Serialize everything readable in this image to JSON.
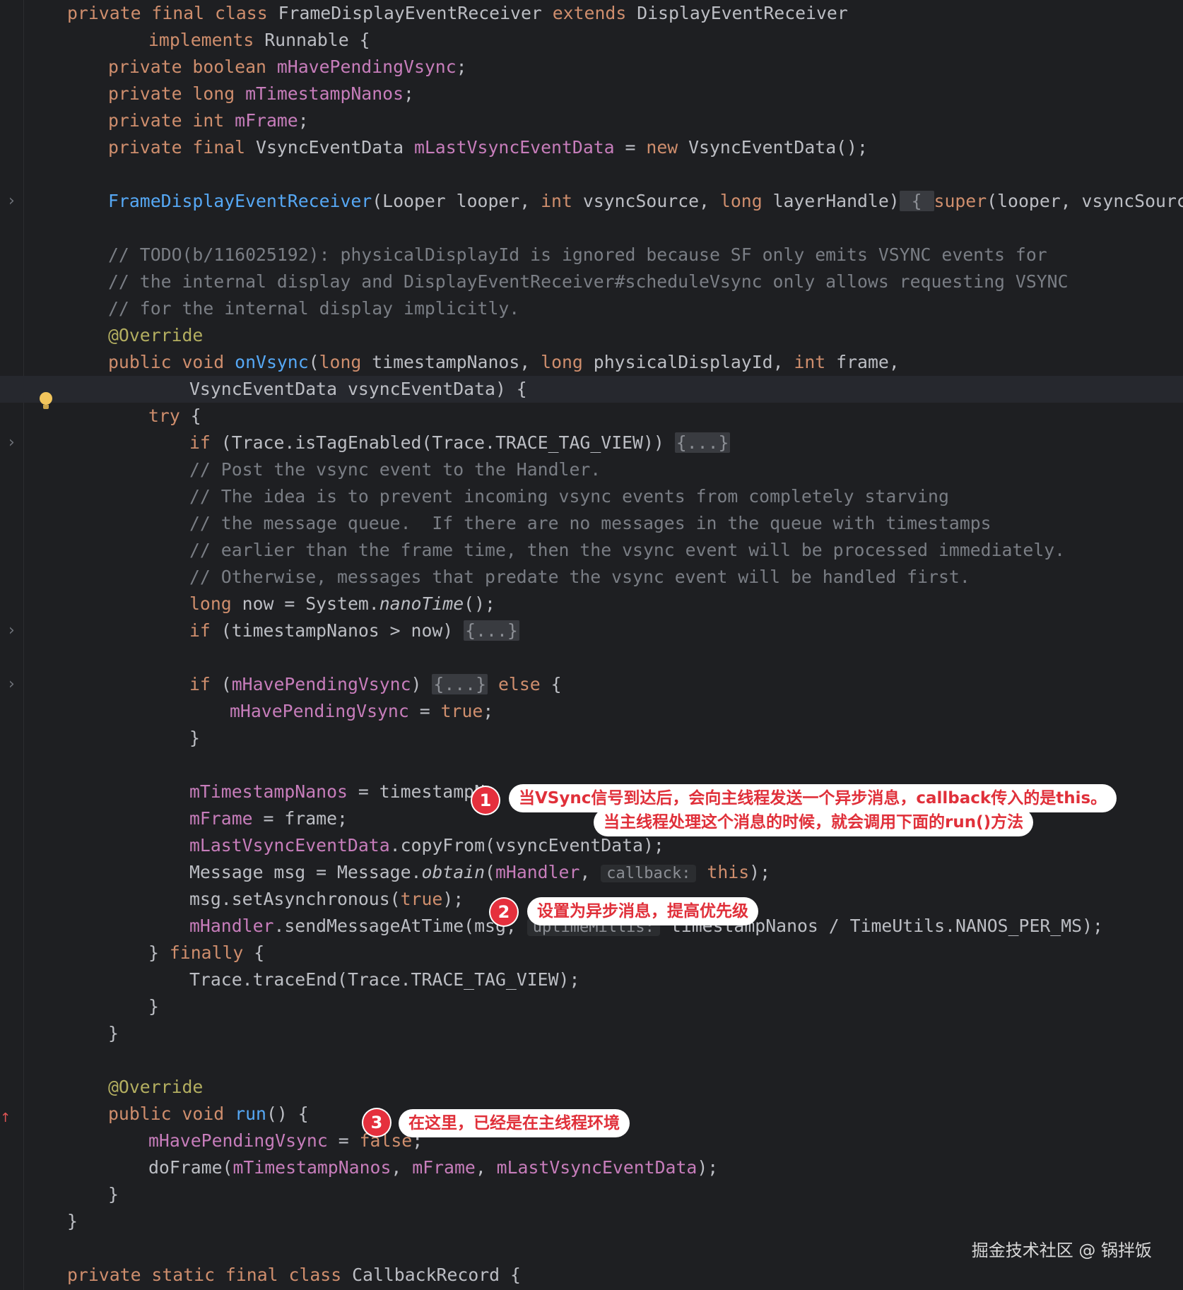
{
  "code": {
    "l1": {
      "a": "private final class ",
      "b": "FrameDisplayEventReceiver ",
      "c": "extends ",
      "d": "DisplayEventReceiver"
    },
    "l2": {
      "a": "implements ",
      "b": "Runnable {"
    },
    "l3": {
      "a": "private boolean ",
      "b": "mHavePendingVsync",
      "c": ";"
    },
    "l4": {
      "a": "private long ",
      "b": "mTimestampNanos",
      "c": ";"
    },
    "l5": {
      "a": "private int ",
      "b": "mFrame",
      "c": ";"
    },
    "l6": {
      "a": "private final ",
      "b": "VsyncEventData ",
      "c": "mLastVsyncEventData",
      "d": " = ",
      "e": "new ",
      "f": "VsyncEventData();"
    },
    "l8": {
      "a": "FrameDisplayEventReceiver",
      "b": "(Looper looper, ",
      "c": "int ",
      "d": "vsyncSource, ",
      "e": "long ",
      "f": "layerHandle)",
      "g": " { ",
      "h": "super",
      "i": "(looper, vsyncSource, /"
    },
    "l10": "// TODO(b/116025192): physicalDisplayId is ignored because SF only emits VSYNC events for",
    "l11": "// the internal display and DisplayEventReceiver#scheduleVsync only allows requesting VSYNC",
    "l12": "// for the internal display implicitly.",
    "l13": "@Override",
    "l14": {
      "a": "public void ",
      "b": "onVsync",
      "c": "(",
      "d": "long ",
      "e": "timestampNanos, ",
      "f": "long ",
      "g": "physicalDisplayId, ",
      "h": "int ",
      "i": "frame,"
    },
    "l15": {
      "a": "VsyncEventData ",
      "b": "vsyncEventData) {"
    },
    "l16": {
      "a": "try ",
      "b": "{"
    },
    "l17": {
      "a": "if ",
      "b": "(Trace.",
      "c": "isTagEnabled",
      "d": "(Trace.",
      "e": "TRACE_TAG_VIEW",
      "f": ")) ",
      "g": "{...}"
    },
    "l18": "// Post the vsync event to the Handler.",
    "l19": "// The idea is to prevent incoming vsync events from completely starving",
    "l20": "// the message queue.  If there are no messages in the queue with timestamps",
    "l21": "// earlier than the frame time, then the vsync event will be processed immediately.",
    "l22": "// Otherwise, messages that predate the vsync event will be handled first.",
    "l23": {
      "a": "long ",
      "b": "now = System.",
      "c": "nanoTime",
      "d": "();"
    },
    "l24": {
      "a": "if ",
      "b": "(timestampNanos > now) ",
      "c": "{...}"
    },
    "l26": {
      "a": "if ",
      "b": "(",
      "c": "mHavePendingVsync",
      "d": ") ",
      "e": "{...}",
      "f": " else ",
      "g": "{"
    },
    "l27": {
      "a": "mHavePendingVsync",
      "b": " = ",
      "c": "true",
      "d": ";"
    },
    "l28": "}",
    "l30": {
      "a": "mTimestampNanos",
      "b": " = timestampN"
    },
    "l31": {
      "a": "mFrame",
      "b": " = frame;"
    },
    "l32": {
      "a": "mLastVsyncEventData",
      "b": ".",
      "c": "copyFrom",
      "d": "(vsyncEventData);"
    },
    "l33": {
      "a": "Message msg = Message.",
      "b": "obtain",
      "c": "(",
      "d": "mHandler",
      "e": ", ",
      "f": "callback:",
      "g": " ",
      "h": "this",
      "i": ");"
    },
    "l34": {
      "a": "msg.setAsynchronous(",
      "b": "true",
      "c": ");"
    },
    "l35": {
      "a": "mHandler",
      "b": ".sendMessageAtTime(msg, ",
      "c": "uptimeMillis:",
      "d": " timestampNanos / TimeUtils.",
      "e": "NANOS_PER_MS",
      "f": ");"
    },
    "l36": {
      "a": "} ",
      "b": "finally ",
      "c": "{"
    },
    "l37": {
      "a": "Trace.",
      "b": "traceEnd",
      "c": "(Trace.",
      "d": "TRACE_TAG_VIEW",
      "e": ");"
    },
    "l38": "}",
    "l39": "}",
    "l41": "@Override",
    "l42": {
      "a": "public void ",
      "b": "run",
      "c": "() {"
    },
    "l43": {
      "a": "mHavePendingVsync",
      "b": " = ",
      "c": "false",
      "d": ";"
    },
    "l44": {
      "a": "doFrame(",
      "b": "mTimestampNanos",
      "c": ", ",
      "d": "mFrame",
      "e": ", ",
      "f": "mLastVsyncEventData",
      "g": ");"
    },
    "l45": "}",
    "l46": "}",
    "l48": {
      "a": "private static final class ",
      "b": "CallbackRecord {"
    }
  },
  "annotations": [
    {
      "num": "1",
      "text1": "当VSync信号到达后，会向主线程发送一个异步消息，callback传入的是this。",
      "text2": "当主线程处理这个消息的时候，就会调用下面的run()方法"
    },
    {
      "num": "2",
      "text1": "设置为异步消息，提高优先级"
    },
    {
      "num": "3",
      "text1": "在这里，已经是在主线程环境"
    }
  ],
  "watermark": "掘金技术社区 @ 锅拌饭",
  "colors": {
    "background": "#1e1f22",
    "keyword": "#cf8e6d",
    "field": "#c77dbb",
    "method": "#56a8f5",
    "comment": "#7a7e85",
    "annotation_red": "#e5303d"
  }
}
